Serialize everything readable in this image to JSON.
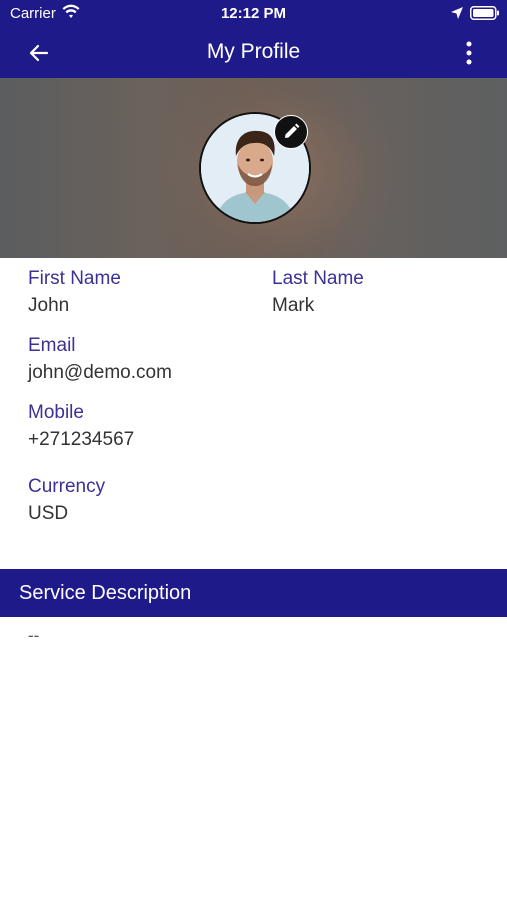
{
  "status": {
    "carrier": "Carrier",
    "time": "12:12 PM"
  },
  "appbar": {
    "title": "My Profile"
  },
  "profile": {
    "first_name_label": "First Name",
    "first_name": "John",
    "last_name_label": "Last Name",
    "last_name": "Mark",
    "email_label": "Email",
    "email": "john@demo.com",
    "mobile_label": "Mobile",
    "mobile": "+271234567",
    "currency_label": "Currency",
    "currency": "USD"
  },
  "service": {
    "title": "Service Description",
    "value": "--"
  },
  "colors": {
    "primary": "#1f1a8a",
    "label": "#3b3196",
    "text": "#333333"
  },
  "icons": {
    "back": "arrow-left-icon",
    "more": "more-vertical-icon",
    "edit": "pencil-icon",
    "wifi": "wifi-icon",
    "location": "location-arrow-icon",
    "battery": "battery-icon"
  }
}
